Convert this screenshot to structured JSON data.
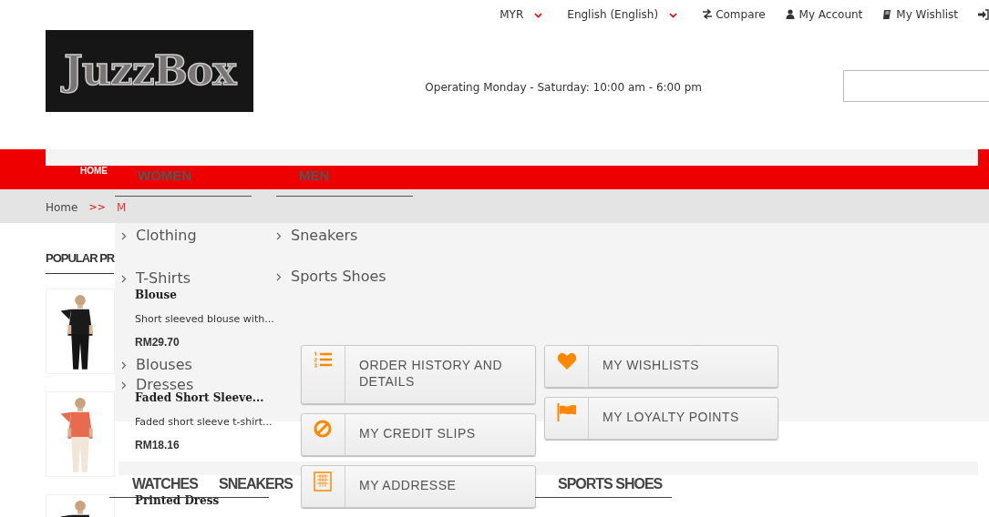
{
  "top_bar": {
    "currency": {
      "label": "MYR"
    },
    "language": {
      "label": "English (English)"
    },
    "links": [
      {
        "kind": "compare",
        "label": "Compare"
      },
      {
        "kind": "account",
        "label": "My Account"
      },
      {
        "kind": "wishlist",
        "label": "My Wishlist"
      },
      {
        "kind": "signin"
      }
    ]
  },
  "header": {
    "logo": "JuzzBox",
    "hours": "Operating Monday - Saturday: 10:00 am - 6:00 pm"
  },
  "nav": {
    "items": [
      {
        "label": "HOME",
        "selected": true
      },
      {
        "label": "WOMEN",
        "selected": false
      },
      {
        "label": "MEN",
        "selected": false
      }
    ]
  },
  "breadcrumb": {
    "items": [
      {
        "label": "Home"
      },
      {
        "label": "M"
      }
    ],
    "separator": ">>"
  },
  "dropdown": {
    "columns": [
      {
        "items": [
          {
            "label": "Clothing"
          },
          {
            "label": "T-Shirts"
          },
          {
            "label": "Blouses"
          },
          {
            "label": "Dresses"
          }
        ]
      },
      {
        "items": [
          {
            "label": "Sneakers"
          },
          {
            "label": "Sports Shoes"
          }
        ]
      }
    ]
  },
  "popular": {
    "title": "POPULAR PR",
    "products": [
      {
        "name": "Blouse",
        "description": "Short sleeved blouse with...",
        "price": "RM29.70",
        "kind": "picture"
      },
      {
        "name": "Faded Short Sleeve...",
        "description": "Faded short sleeve t-shirt...",
        "price": "RM18.16",
        "kind": "picture"
      },
      {
        "name": "Printed Dress",
        "kind": "picture"
      }
    ]
  },
  "account_buttons": [
    {
      "kind": "list",
      "label": "ORDER HISTORY AND DETAILS"
    },
    {
      "kind": "ban",
      "label": "MY CREDIT SLIPS"
    },
    {
      "kind": "building",
      "label": "MY ADDRESSE"
    },
    {
      "kind": "heart",
      "label": "MY WISHLISTS"
    },
    {
      "kind": "flag",
      "label": "MY LOYALTY POINTS"
    }
  ],
  "bottom_menu": [
    "WATCHES",
    "SNEAKERS",
    "SPORTS SHOES"
  ]
}
